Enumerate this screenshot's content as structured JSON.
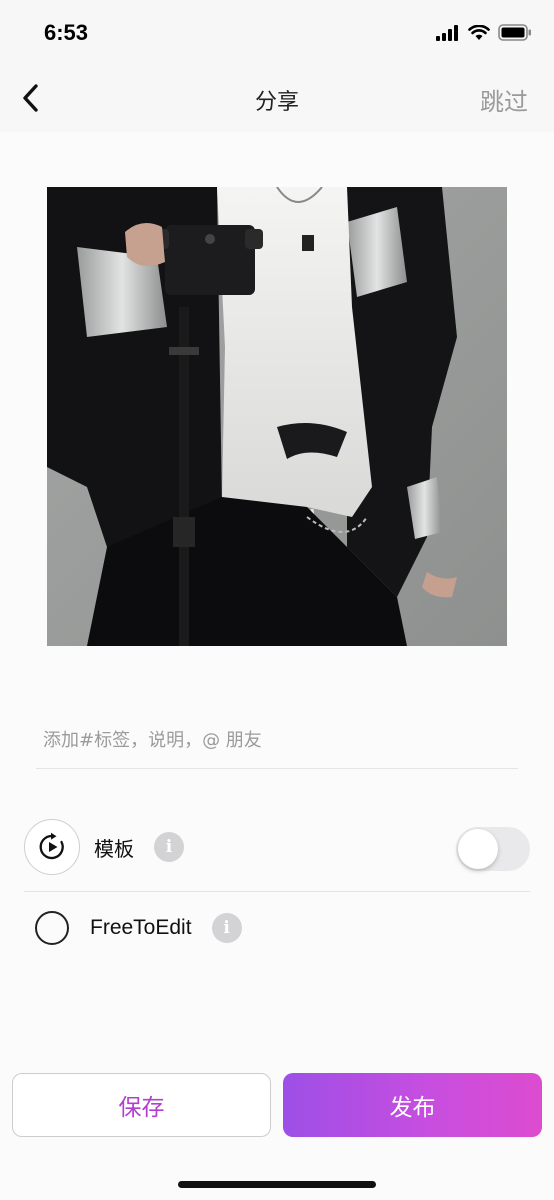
{
  "status_bar": {
    "time": "6:53",
    "icons": [
      "signal-icon",
      "wifi-icon",
      "battery-icon"
    ]
  },
  "nav": {
    "back_icon": "chevron-left-icon",
    "title": "分享",
    "skip_label": "跳过"
  },
  "share": {
    "photo_icon": "photo-preview",
    "caption_placeholder": "添加#标签，说明，@ 朋友",
    "caption_value": "",
    "template": {
      "icon": "play-rotate-icon",
      "label": "模板",
      "info_icon": "info-icon",
      "info_glyph": "i",
      "toggle_on": false
    },
    "free_to_edit": {
      "label": "FreeToEdit",
      "info_icon": "info-icon",
      "info_glyph": "i",
      "checked": false
    }
  },
  "actions": {
    "save_label": "保存",
    "publish_label": "发布"
  },
  "colors": {
    "accent_purple": "#b23fcd",
    "gradient_start": "#9d4fe6",
    "gradient_end": "#dd4ccf",
    "toggle_off": "#e9e9ec"
  }
}
